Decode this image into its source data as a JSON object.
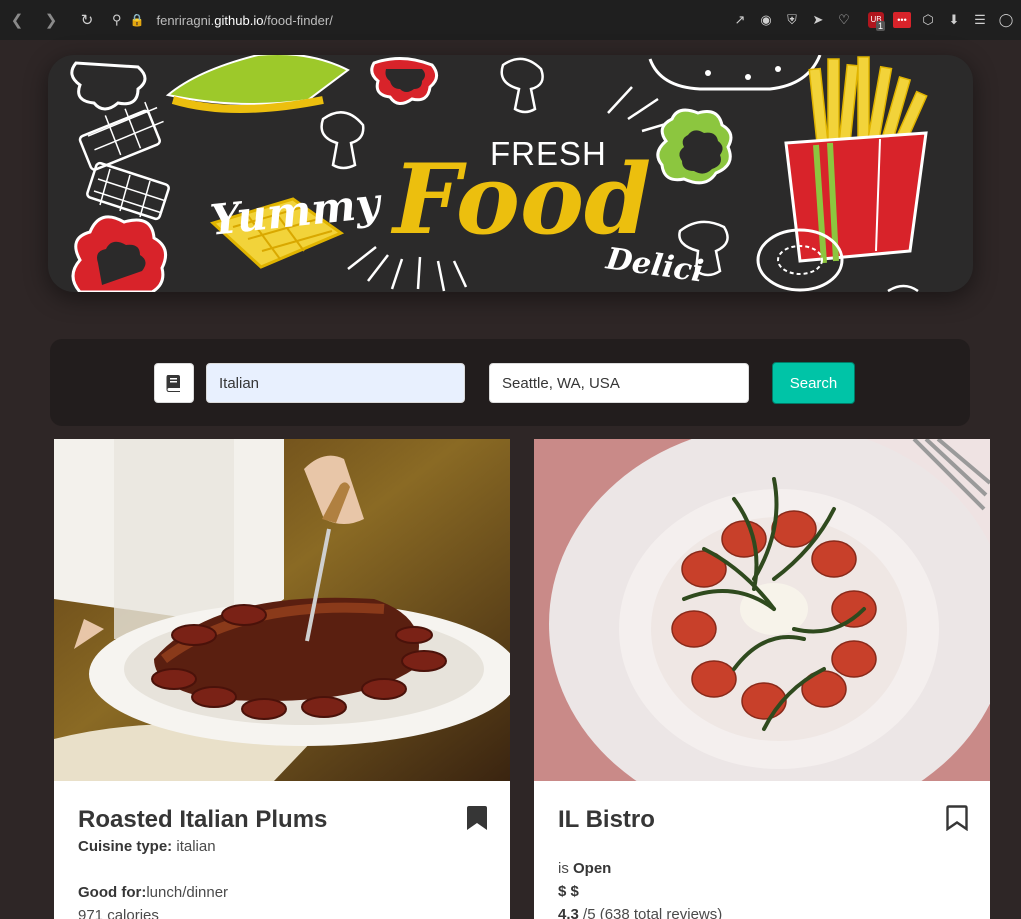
{
  "browser": {
    "url_prefix": "fenriragni.",
    "url_domain": "github.io",
    "url_path": "/food-finder/",
    "ublock_count": "1",
    "icons": [
      "back-arrow-icon",
      "forward-arrow-icon",
      "reload-icon",
      "tracking-icon",
      "lock-icon",
      "share-icon",
      "screenshot-icon",
      "shield-icon",
      "send-icon",
      "heart-icon",
      "ublock-icon",
      "password-icon",
      "box-icon",
      "download-icon",
      "menu-icon",
      "profile-icon"
    ]
  },
  "hero": {
    "yummy": "Yummy",
    "fresh": "FRESH",
    "food": "Food",
    "delici": "Delici"
  },
  "search": {
    "query_value": "Italian",
    "location_value": "Seattle, WA, USA",
    "button_label": "Search",
    "book_icon": "book-icon"
  },
  "cards": [
    {
      "title": "Roasted Italian Plums",
      "cuisine_label": "Cuisine type:",
      "cuisine_value": " italian",
      "goodfor_label": "Good for:",
      "goodfor_value": "lunch/dinner",
      "calories": "971 calories",
      "bookmark": "bookmark-filled-icon"
    },
    {
      "title": "IL Bistro",
      "status_prefix": "is ",
      "status_value": "Open",
      "price": "$ $",
      "rating_value": "4.3",
      "rating_suffix": " /5 (638 total reviews)",
      "bookmark": "bookmark-outline-icon"
    }
  ],
  "colors": {
    "page_bg": "#2e2626",
    "panel_bg": "#221d1d",
    "accent": "#00c4a7",
    "food_yellow": "#ecbf0e"
  }
}
